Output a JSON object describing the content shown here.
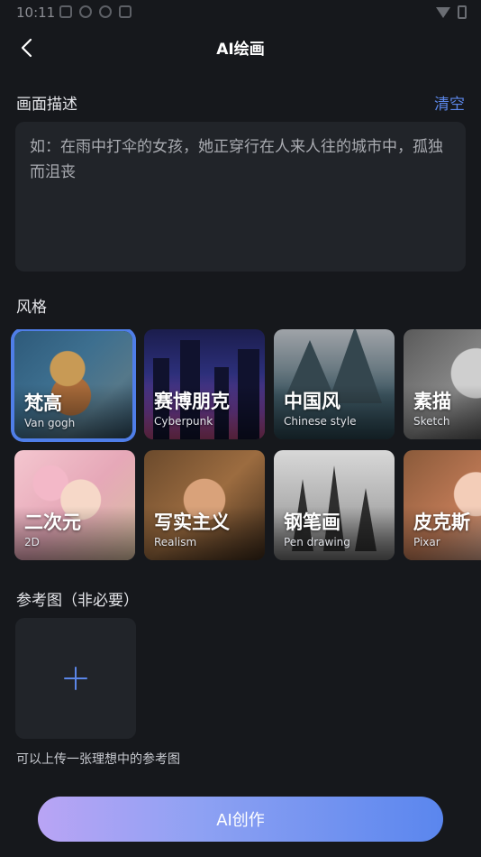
{
  "status_bar": {
    "time": "10:11"
  },
  "header": {
    "title": "AI绘画"
  },
  "description": {
    "label": "画面描述",
    "clear_label": "清空",
    "placeholder": "如：在雨中打伞的女孩，她正穿行在人来人往的城市中，孤独而沮丧"
  },
  "style": {
    "label": "风格",
    "selected": "梵高",
    "items": [
      {
        "name_cn": "梵高",
        "name_en": "Van gogh"
      },
      {
        "name_cn": "赛博朋克",
        "name_en": "Cyberpunk"
      },
      {
        "name_cn": "中国风",
        "name_en": "Chinese style"
      },
      {
        "name_cn": "素描",
        "name_en": "Sketch"
      },
      {
        "name_cn": "二次元",
        "name_en": "2D"
      },
      {
        "name_cn": "写实主义",
        "name_en": "Realism"
      },
      {
        "name_cn": "钢笔画",
        "name_en": "Pen drawing"
      },
      {
        "name_cn": "皮克斯",
        "name_en": "Pixar"
      }
    ]
  },
  "reference": {
    "label": "参考图（非必要）",
    "hint": "可以上传一张理想中的参考图"
  },
  "action": {
    "create_label": "AI创作"
  },
  "colors": {
    "accent": "#5b86e8",
    "background": "#16181c",
    "panel": "#212429"
  }
}
